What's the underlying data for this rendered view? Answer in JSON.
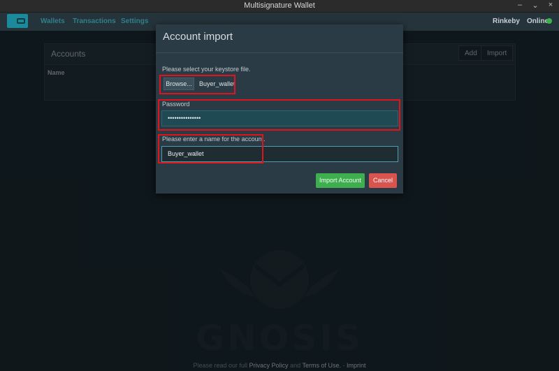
{
  "window": {
    "title": "Multisignature Wallet",
    "controls": [
      "–",
      "⌄",
      "×"
    ]
  },
  "navbar": {
    "links": [
      "Wallets",
      "Transactions",
      "Settings"
    ],
    "network": "Rinkeby",
    "status": "Online",
    "status_color": "#3cb34a"
  },
  "accounts_panel": {
    "title": "Accounts",
    "add_label": "Add",
    "import_label": "Import",
    "column_name": "Name"
  },
  "modal": {
    "title": "Account import",
    "keystore_prompt": "Please select your keystore file.",
    "browse_label": "Browse...",
    "selected_file": "Buyer_wallet",
    "password_label": "Password",
    "password_value": "•••••••••••••••",
    "name_prompt": "Please enter a name for the account.",
    "name_value": "Buyer_wallet",
    "import_button": "Import Account",
    "cancel_button": "Cancel",
    "import_color": "#3fae4f",
    "cancel_color": "#d9534f"
  },
  "watermark": {
    "text": "GNOSIS"
  },
  "footer": {
    "prefix": "Please read our full",
    "privacy": "Privacy Policy",
    "and": "and",
    "terms": "Terms of Use.",
    "dash": "-",
    "imprint": "Imprint"
  },
  "annotation_color": "#e0141c"
}
